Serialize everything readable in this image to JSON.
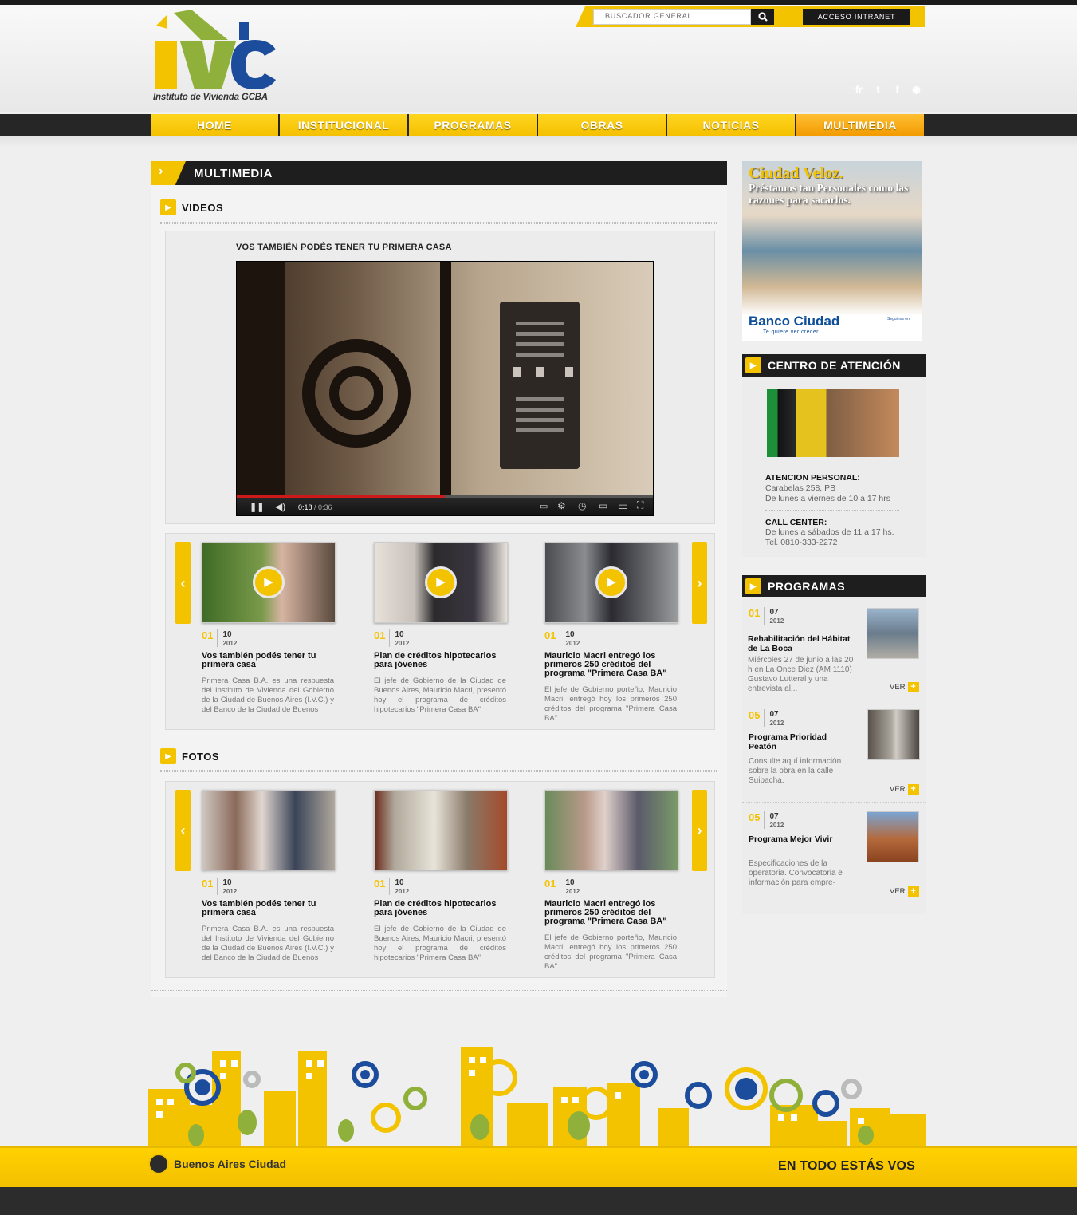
{
  "header": {
    "logo_letters": "IVC",
    "logo_tagline": "Instituto de Vivienda GCBA",
    "search_placeholder": "BUSCADOR GENERAL",
    "intranet_label": "ACCESO INTRANET",
    "social": [
      {
        "icon": "friendfeed-icon",
        "glyph": "fr",
        "color": "#e3187f"
      },
      {
        "icon": "twitter-icon",
        "glyph": "t",
        "color": "#2fb5e8"
      },
      {
        "icon": "facebook-icon",
        "glyph": "f",
        "color": "#3b5998"
      },
      {
        "icon": "rss-icon",
        "glyph": "◉",
        "color": "#f58a1f"
      }
    ]
  },
  "nav": {
    "items": [
      "HOME",
      "INSTITUCIONAL",
      "PROGRAMAS",
      "OBRAS",
      "NOTICIAS",
      "MULTIMEDIA"
    ],
    "active": "MULTIMEDIA"
  },
  "main": {
    "title": "MULTIMEDIA",
    "videos": {
      "heading": "VIDEOS",
      "featured_title": "VOS TAMBIÉN PODÉS TENER TU PRIMERA CASA",
      "player": {
        "time_current": "0:18",
        "time_total": "/ 0:36",
        "progress": 0.5
      }
    },
    "video_cards": [
      {
        "day": "01",
        "month": "10",
        "year": "2012",
        "title": "Vos también podés tener tu primera casa",
        "text": "Primera Casa B.A. es una respuesta del Instituto de Vivienda del Gobierno de la Ciudad de Buenos Aires (I.V.C.) y del Banco de la Ciudad de Buenos"
      },
      {
        "day": "01",
        "month": "10",
        "year": "2012",
        "title": "Plan de créditos hipotecarios para jóvenes",
        "text": "El jefe de Gobierno de la Ciudad de Buenos Aires, Mauricio Macri, presentó hoy el programa de créditos hipotecarios \"Primera Casa BA\""
      },
      {
        "day": "01",
        "month": "10",
        "year": "2012",
        "title": "Mauricio Macri entregó los primeros 250 créditos del programa \"Primera Casa BA\"",
        "text": "El jefe de Gobierno porteño, Mauricio Macri, entregó hoy los primeros 250 créditos del programa \"Primera Casa BA\""
      }
    ],
    "fotos": {
      "heading": "FOTOS"
    },
    "foto_cards": [
      {
        "day": "01",
        "month": "10",
        "year": "2012",
        "title": "Vos también podés tener tu primera casa",
        "text": "Primera Casa B.A. es una respuesta del Instituto de Vivienda del Gobierno de la Ciudad de Buenos Aires (I.V.C.) y del Banco de la Ciudad de Buenos"
      },
      {
        "day": "01",
        "month": "10",
        "year": "2012",
        "title": "Plan de créditos hipotecarios para jóvenes",
        "text": "El jefe de Gobierno de la Ciudad de Buenos Aires, Mauricio Macri, presentó hoy el programa de créditos hipotecarios \"Primera Casa BA\""
      },
      {
        "day": "01",
        "month": "10",
        "year": "2012",
        "title": "Mauricio Macri entregó los primeros 250 créditos del programa \"Primera Casa BA\"",
        "text": "El jefe de Gobierno porteño, Mauricio Macri, entregó hoy los primeros 250 créditos del programa \"Primera Casa BA\""
      }
    ]
  },
  "sidebar": {
    "ad": {
      "headline": "Ciudad Veloz.",
      "subline": "Préstamos tan Personales como las razones para sacarlos.",
      "bank": "Banco Ciudad",
      "slogan": "Te quiere ver crecer",
      "follow": "Seguinos en:"
    },
    "centro": {
      "heading": "CENTRO DE ATENCIÓN",
      "personal_title": "ATENCION PERSONAL:",
      "personal_address": "Carabelas 258, PB",
      "personal_hours": "De lunes a viernes de 10 a 17 hrs",
      "call_title": "CALL CENTER:",
      "call_hours": "De lunes a sábados de 11 a 17 hs.",
      "call_phone": "Tel. 0810-333-2272"
    },
    "programas": {
      "heading": "PROGRAMAS",
      "ver_label": "VER",
      "items": [
        {
          "day": "01",
          "month": "07",
          "year": "2012",
          "title": "Rehabilitación del Hábitat de La Boca",
          "text": "Miércoles 27 de junio a las 20 h en La Once Diez (AM 1110) Gustavo Lutteral y una entrevista al..."
        },
        {
          "day": "05",
          "month": "07",
          "year": "2012",
          "title": "Programa Prioridad Peatón",
          "text": "Consulte aquí información sobre la obra en la calle Suipacha."
        },
        {
          "day": "05",
          "month": "07",
          "year": "2012",
          "title": "Programa Mejor Vivir",
          "text": "Especificaciones de la operatoria. Convocatoria e información para empre-"
        }
      ]
    }
  },
  "footer": {
    "ba_logo": "Buenos Aires Ciudad",
    "slogan": "EN TODO ESTÁS VOS"
  },
  "colors": {
    "accent": "#f4c300",
    "dark": "#1e1e1e",
    "logo_green": "#8fb03a",
    "logo_blue": "#1c4c9c"
  }
}
